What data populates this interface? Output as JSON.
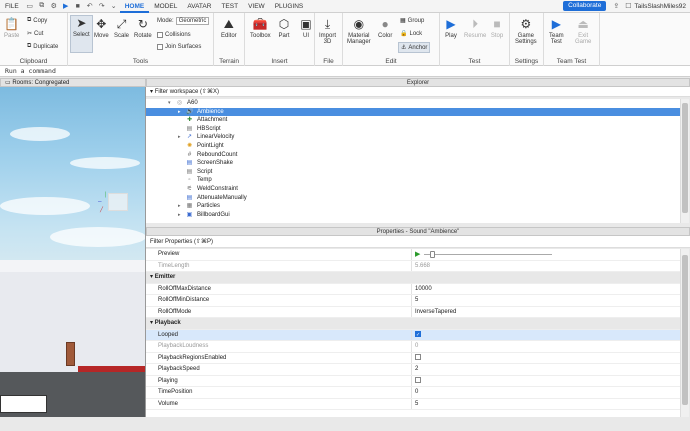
{
  "menubar": {
    "file": "FILE",
    "tabs": [
      "HOME",
      "MODEL",
      "AVATAR",
      "TEST",
      "VIEW",
      "PLUGINS"
    ],
    "active_tab": "HOME",
    "collaborate": "Collaborate",
    "username": "TailsSlashMiles92"
  },
  "ribbon": {
    "clipboard": {
      "title": "Clipboard",
      "paste": "Paste",
      "copy": "Copy",
      "cut": "Cut",
      "duplicate": "Duplicate"
    },
    "tools": {
      "title": "Tools",
      "select": "Select",
      "move": "Move",
      "scale": "Scale",
      "rotate": "Rotate",
      "mode_label": "Mode:",
      "mode_value": "Geometric",
      "collisions": "Collisions",
      "join_surfaces": "Join Surfaces"
    },
    "terrain": {
      "title": "Terrain",
      "editor": "Editor"
    },
    "insert": {
      "title": "Insert",
      "toolbox": "Toolbox",
      "part": "Part",
      "ui": "UI"
    },
    "file": {
      "title": "File",
      "import": "Import",
      "import2": "3D"
    },
    "edit": {
      "title": "Edit",
      "material": "Material",
      "manager": "Manager",
      "color": "Color",
      "group": "Group",
      "lock": "Lock",
      "anchor": "Anchor"
    },
    "test": {
      "title": "Test",
      "play": "Play",
      "resume": "Resume",
      "stop": "Stop"
    },
    "settings": {
      "title": "Settings",
      "game": "Game",
      "settings": "Settings"
    },
    "team_test": {
      "title": "Team Test",
      "team": "Team",
      "test": "Test",
      "exit": "Exit",
      "game": "Game"
    }
  },
  "command": {
    "placeholder": "Run a command"
  },
  "viewport": {
    "tab": "Rooms: Congregated"
  },
  "explorer": {
    "header": "Explorer",
    "filter": "Filter workspace (⇧⌘X)",
    "items": [
      {
        "label": "A60",
        "indent": 0
      },
      {
        "label": "Ambience",
        "indent": 1,
        "selected": true
      },
      {
        "label": "Attachment",
        "indent": 2
      },
      {
        "label": "HBScript",
        "indent": 2
      },
      {
        "label": "LinearVelocity",
        "indent": 1
      },
      {
        "label": "PointLight",
        "indent": 2
      },
      {
        "label": "ReboundCount",
        "indent": 2
      },
      {
        "label": "ScreenShake",
        "indent": 2
      },
      {
        "label": "Script",
        "indent": 2
      },
      {
        "label": "Temp",
        "indent": 2
      },
      {
        "label": "WeldConstraint",
        "indent": 2
      },
      {
        "label": "AttenuateManually",
        "indent": 2
      },
      {
        "label": "Particles",
        "indent": 1
      },
      {
        "label": "BillboardGui",
        "indent": 1
      }
    ]
  },
  "properties": {
    "header": "Properties - Sound \"Ambience\"",
    "filter": "Filter Properties (⇧⌘P)",
    "rows": [
      {
        "name": "Preview",
        "kind": "preview"
      },
      {
        "name": "TimeLength",
        "value": "5.668",
        "dim": true
      },
      {
        "name": "Emitter",
        "kind": "category"
      },
      {
        "name": "RollOffMaxDistance",
        "value": "10000"
      },
      {
        "name": "RollOffMinDistance",
        "value": "5"
      },
      {
        "name": "RollOffMode",
        "value": "InverseTapered"
      },
      {
        "name": "Playback",
        "kind": "category"
      },
      {
        "name": "Looped",
        "kind": "checkbox",
        "checked": true,
        "highlight": true
      },
      {
        "name": "PlaybackLoudness",
        "value": "0",
        "dim": true
      },
      {
        "name": "PlaybackRegionsEnabled",
        "kind": "checkbox",
        "checked": false
      },
      {
        "name": "PlaybackSpeed",
        "value": "2"
      },
      {
        "name": "Playing",
        "kind": "checkbox",
        "checked": false
      },
      {
        "name": "TimePosition",
        "value": "0"
      },
      {
        "name": "Volume",
        "value": "5"
      }
    ]
  }
}
